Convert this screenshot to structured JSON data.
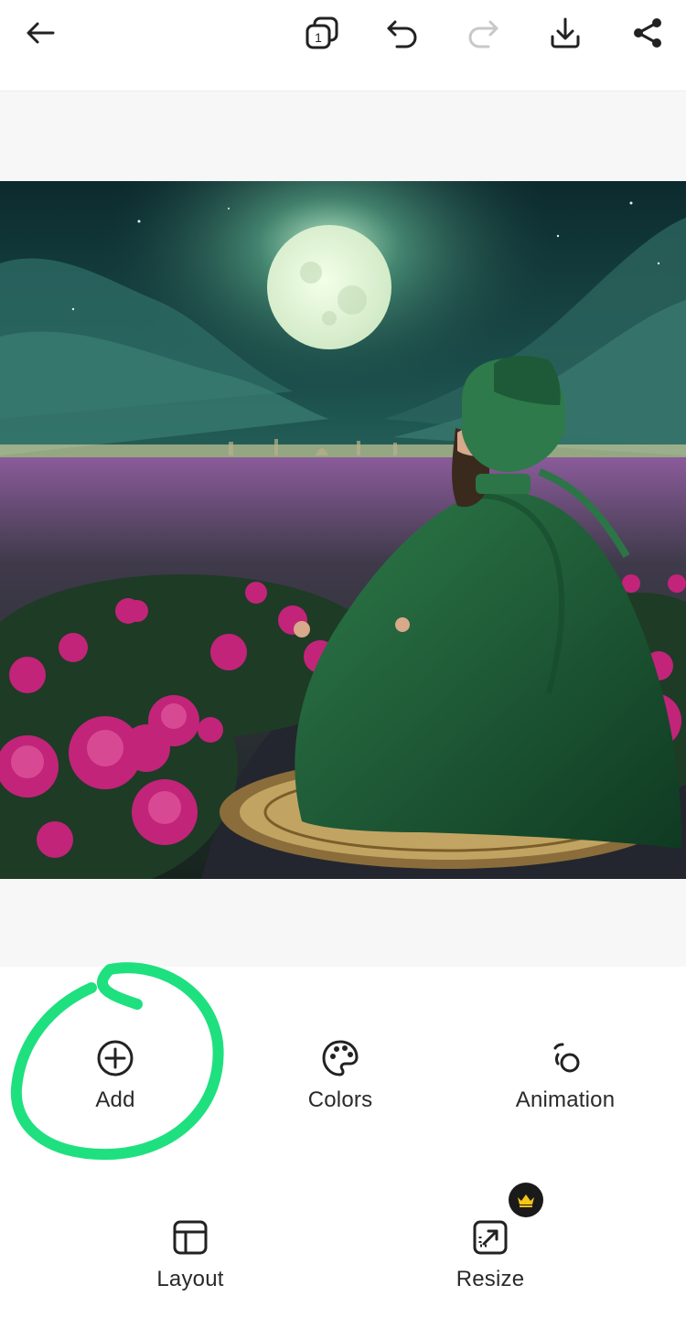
{
  "toolbar": {
    "back_icon": "arrow-left-icon",
    "pages_icon": "pages-stack-icon",
    "pages_count": "1",
    "undo_icon": "undo-icon",
    "redo_icon": "redo-icon",
    "download_icon": "download-icon",
    "share_icon": "share-icon",
    "redo_enabled": false
  },
  "canvas": {
    "image_subject": "moonlit-rose-field-artwork"
  },
  "tools": {
    "row1": [
      {
        "label": "Add",
        "icon": "plus-circle-icon"
      },
      {
        "label": "Colors",
        "icon": "palette-icon"
      },
      {
        "label": "Animation",
        "icon": "animation-icon"
      }
    ],
    "row2": [
      {
        "label": "Layout",
        "icon": "layout-icon"
      },
      {
        "label": "Resize",
        "icon": "resize-icon",
        "premium": true
      }
    ]
  },
  "colors": {
    "annotation": "#1ee07f",
    "premium_badge": "#1a1a1a",
    "crown": "#f5c518",
    "disabled_icon": "#c8c8c8"
  }
}
